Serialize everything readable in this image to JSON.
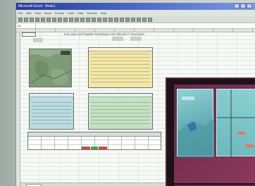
{
  "window": {
    "title": "Microsoft Excel - Book1"
  },
  "menubar": {
    "items": [
      "File",
      "Edit",
      "View",
      "Insert",
      "Format",
      "Tools",
      "Data",
      "Window",
      "Help"
    ]
  },
  "formula_bar": {
    "name_box": "A1"
  },
  "sheet": {
    "title": "PUC AND SOFTWARE PROGRAM FOR PROJECT TRACKING"
  },
  "icons": {
    "toolbar_count": 24
  },
  "colors": {
    "map_panel": "#7f9a76",
    "yellow_panel": "#f2e7a6",
    "blue_panel": "#b9dbe1",
    "green_panel": "#c4e2c4",
    "red_cell": "#d24a3a",
    "green_cell": "#3ea64a",
    "overlay_magenta": "#8b3a5c",
    "overlay_cyan": "#8fd3d6"
  }
}
